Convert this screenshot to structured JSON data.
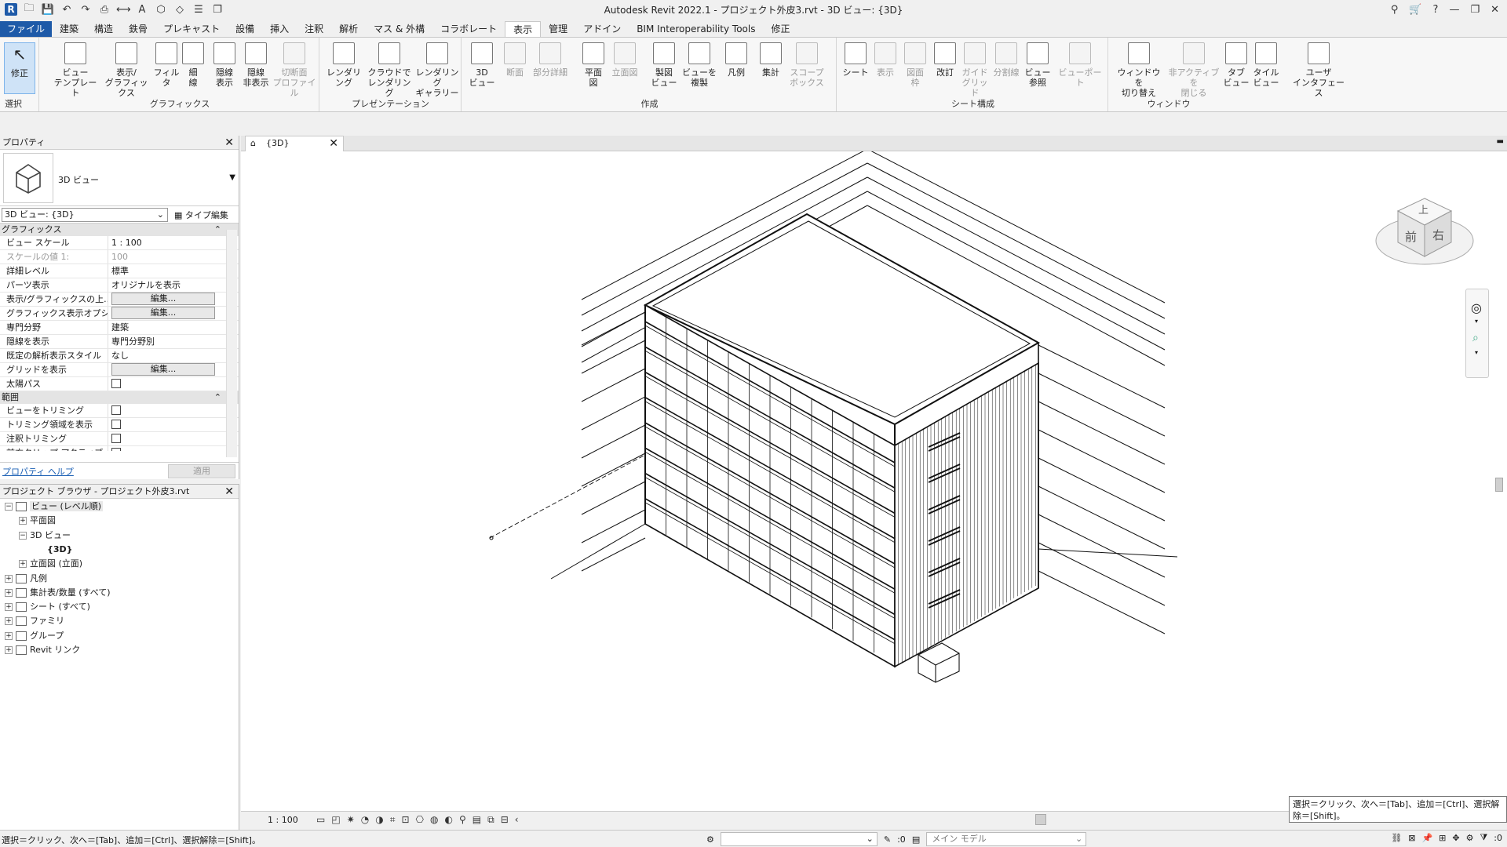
{
  "window": {
    "title": "Autodesk Revit 2022.1 - プロジェクト外皮3.rvt - 3D ビュー: {3D}",
    "app_logo": "R"
  },
  "ribbon_tabs": [
    "ファイル",
    "建築",
    "構造",
    "鉄骨",
    "プレキャスト",
    "設備",
    "挿入",
    "注釈",
    "解析",
    "マス & 外構",
    "コラボレート",
    "表示",
    "管理",
    "アドイン",
    "BIM Interoperability Tools",
    "修正"
  ],
  "ribbon": {
    "select": {
      "modify": "修正",
      "select": "選択"
    },
    "groups": [
      {
        "title": "グラフィックス",
        "buttons": [
          "ビュー\nテンプレート",
          "表示/\nグラフィックス",
          "フィルタ",
          "細\n線",
          "隠線\n表示",
          "隠線\n非表示",
          "切断面\nプロファイル"
        ]
      },
      {
        "title": "プレゼンテーション",
        "buttons": [
          "レンダリング",
          "クラウドで\nレンダリング",
          "レンダリング\nギャラリー"
        ]
      },
      {
        "title": "作成",
        "buttons": [
          "3D\nビュー",
          "断面",
          "部分詳細",
          "平面\n図",
          "立面図",
          "製図\nビュー",
          "ビューを\n複製",
          "凡例",
          "集計",
          "スコープ\nボックス"
        ]
      },
      {
        "title": "シート構成",
        "buttons": [
          "シート",
          "表示",
          "図面\n枠",
          "改訂",
          "ガイド\nグリッド",
          "分割線",
          "ビュー\n参照",
          "ビューポート"
        ]
      },
      {
        "title": "ウィンドウ",
        "buttons": [
          "ウィンドウを\n切り替え",
          "非アクティブを\n閉じる",
          "タブ\nビュー",
          "タイル\nビュー",
          "ユーザ\nインタフェース"
        ]
      }
    ]
  },
  "properties": {
    "title": "プロパティ",
    "type_name": "3D ビュー",
    "instance": "3D ビュー: {3D}",
    "type_edit": "タイプ編集",
    "sections": {
      "graphics": "グラフィックス",
      "extents": "範囲"
    },
    "rows": [
      {
        "k": "ビュー スケール",
        "v": "1 : 100"
      },
      {
        "k": "スケールの値    1:",
        "v": "100",
        "gray": true
      },
      {
        "k": "詳細レベル",
        "v": "標準"
      },
      {
        "k": "パーツ表示",
        "v": "オリジナルを表示"
      },
      {
        "k": "表示/グラフィックスの上...",
        "v": "編集...",
        "button": true
      },
      {
        "k": "グラフィックス表示オプション",
        "v": "編集...",
        "button": true
      },
      {
        "k": "専門分野",
        "v": "建築"
      },
      {
        "k": "隠線を表示",
        "v": "専門分野別"
      },
      {
        "k": "既定の解析表示スタイル",
        "v": "なし"
      },
      {
        "k": "グリッドを表示",
        "v": "編集...",
        "button": true
      },
      {
        "k": "太陽パス",
        "v": "",
        "check": true
      }
    ],
    "extent_rows": [
      {
        "k": "ビューをトリミング",
        "check": true
      },
      {
        "k": "トリミング領域を表示",
        "check": true
      },
      {
        "k": "注釈トリミング",
        "check": true
      },
      {
        "k": "前方クリップ アクティブ",
        "check": true
      }
    ],
    "help": "プロパティ ヘルプ",
    "apply": "適用"
  },
  "browser": {
    "title": "プロジェクト ブラウザ - プロジェクト外皮3.rvt",
    "items": [
      {
        "label": "ビュー (レベル順)",
        "level": 0,
        "tw": "−",
        "hl": true
      },
      {
        "label": "平面図",
        "level": 1,
        "tw": "+"
      },
      {
        "label": "3D ビュー",
        "level": 1,
        "tw": "−"
      },
      {
        "label": "{3D}",
        "level": 2,
        "tw": "",
        "bold": true
      },
      {
        "label": "立面図 (立面)",
        "level": 1,
        "tw": "+"
      },
      {
        "label": "凡例",
        "level": 0,
        "tw": "+"
      },
      {
        "label": "集計表/数量 (すべて)",
        "level": 0,
        "tw": "+"
      },
      {
        "label": "シート (すべて)",
        "level": 0,
        "tw": "+"
      },
      {
        "label": "ファミリ",
        "level": 0,
        "tw": "+"
      },
      {
        "label": "グループ",
        "level": 0,
        "tw": "+"
      },
      {
        "label": "Revit リンク",
        "level": 0,
        "tw": "+"
      }
    ]
  },
  "view_tab": {
    "label": "{3D}"
  },
  "viewcube": {
    "top": "上",
    "front": "前",
    "right": "右"
  },
  "view_control": {
    "scale": "1 : 100"
  },
  "tooltip": "選択＝クリック、次へ＝[Tab]、追加＝[Ctrl]、選択解除＝[Shift]。",
  "status": {
    "text": "選択＝クリック、次へ＝[Tab]、追加＝[Ctrl]、選択解除＝[Shift]。",
    "count": ":0",
    "model": "メイン モデル",
    "filter_count": ":0"
  }
}
